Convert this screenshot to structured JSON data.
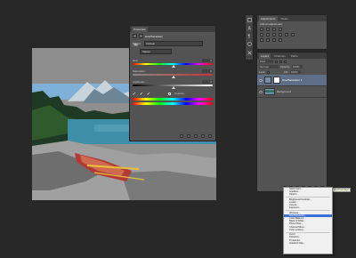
{
  "properties": {
    "tabs": [
      "Properties"
    ],
    "title": "Hue/Saturation",
    "preset_label": "Preset:",
    "preset_value": "Default",
    "channel_value": "Master",
    "hue_label": "Hue:",
    "hue_value": "0",
    "saturation_label": "Saturation:",
    "saturation_value": "0",
    "lightness_label": "Lightness:",
    "lightness_value": "0",
    "colorize_label": "Colorize"
  },
  "adjustments": {
    "tabs": [
      "Adjustments",
      "Styles"
    ],
    "header": "Add an adjustment"
  },
  "layers": {
    "tabs": [
      "Layers",
      "Channels",
      "Paths"
    ],
    "kind_value": "Kind",
    "blend_value": "Normal",
    "opacity_label": "Opacity:",
    "opacity_value": "100%",
    "lock_label": "Lock:",
    "fill_label": "Fill:",
    "fill_value": "100%",
    "rows": [
      {
        "name": "Hue/Saturation 1"
      },
      {
        "name": "Background"
      }
    ]
  },
  "menu": {
    "tooltip": "Create new fill or adjustment layer",
    "items": [
      "Solid Color...",
      "Gradient...",
      "Pattern...",
      "—",
      "Brightness/Contrast...",
      "Levels...",
      "Curves...",
      "Exposure...",
      "—",
      "Vibrance...",
      "Hue/Saturation...",
      "Color Balance...",
      "Black & White...",
      "Photo Filter...",
      "Channel Mixer...",
      "Color Lookup...",
      "—",
      "Invert",
      "Posterize...",
      "Threshold...",
      "Gradient Map..."
    ],
    "selected": "Hue/Saturation..."
  },
  "colors": {
    "app_bg": "#282828",
    "panel_bg": "#535353",
    "selection": "#3a6fd8"
  }
}
